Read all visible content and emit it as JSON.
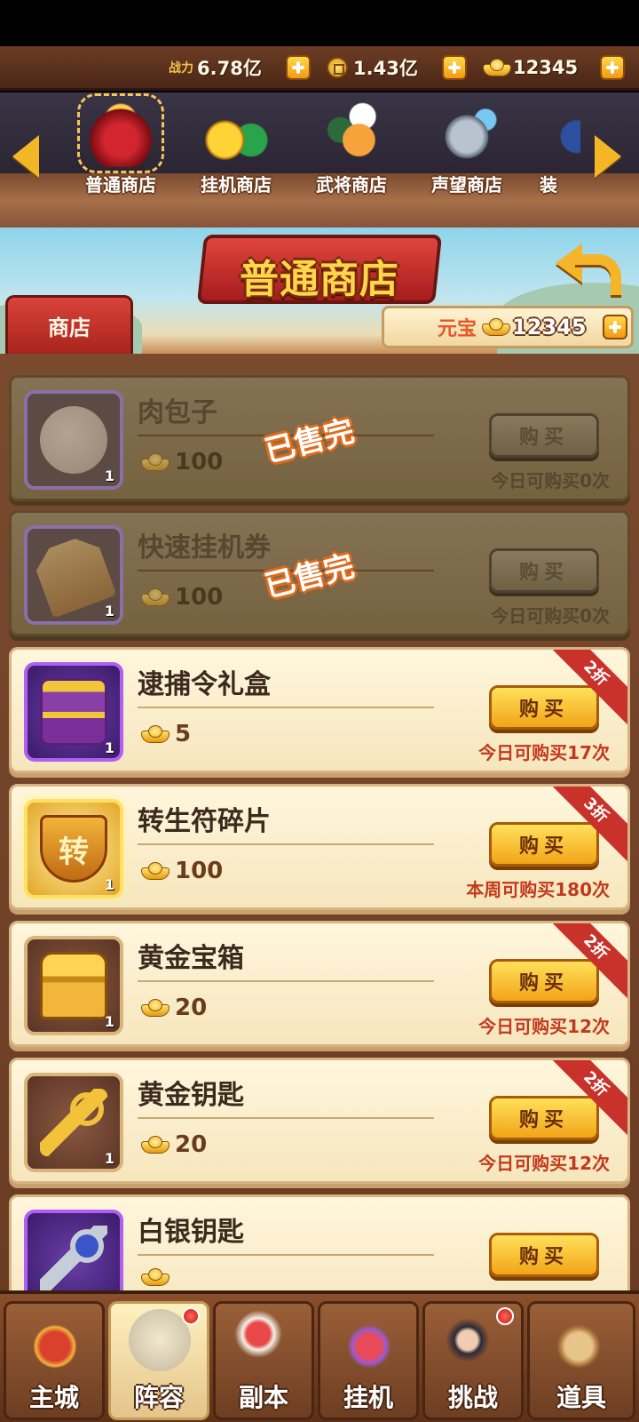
{
  "resources": {
    "power_label": "战力",
    "power_value": "6.78亿",
    "coins_value": "1.43亿",
    "ingots_value": "12345"
  },
  "tabs": [
    {
      "label": "普通商店",
      "active": true
    },
    {
      "label": "挂机商店"
    },
    {
      "label": "武将商店"
    },
    {
      "label": "声望商店"
    },
    {
      "label": "装"
    }
  ],
  "header": {
    "title": "普通商店",
    "shop_tag": "商店",
    "balance_label": "元宝",
    "balance_value": "12345"
  },
  "items": [
    {
      "name": "肉包子",
      "price": "100",
      "qty": "1",
      "buy": "购买",
      "limit": "今日可购买0次",
      "sold_out": "已售完"
    },
    {
      "name": "快速挂机券",
      "price": "100",
      "qty": "1",
      "buy": "购买",
      "limit": "今日可购买0次",
      "sold_out": "已售完"
    },
    {
      "name": "逮捕令礼盒",
      "price": "5",
      "qty": "1",
      "buy": "购买",
      "limit": "今日可购买17次",
      "discount": "2折"
    },
    {
      "name": "转生符碎片",
      "price": "100",
      "qty": "1",
      "buy": "购买",
      "limit": "本周可购买180次",
      "discount": "3折",
      "icon_text": "转"
    },
    {
      "name": "黄金宝箱",
      "price": "20",
      "qty": "1",
      "buy": "购买",
      "limit": "今日可购买12次",
      "discount": "2折"
    },
    {
      "name": "黄金钥匙",
      "price": "20",
      "qty": "1",
      "buy": "购买",
      "limit": "今日可购买12次",
      "discount": "2折"
    },
    {
      "name": "白银钥匙",
      "buy": "购买"
    }
  ],
  "bottom_nav": [
    {
      "label": "主城"
    },
    {
      "label": "阵容",
      "selected": true,
      "badge": true
    },
    {
      "label": "副本"
    },
    {
      "label": "挂机"
    },
    {
      "label": "挑战",
      "badge": true
    },
    {
      "label": "道具"
    }
  ]
}
